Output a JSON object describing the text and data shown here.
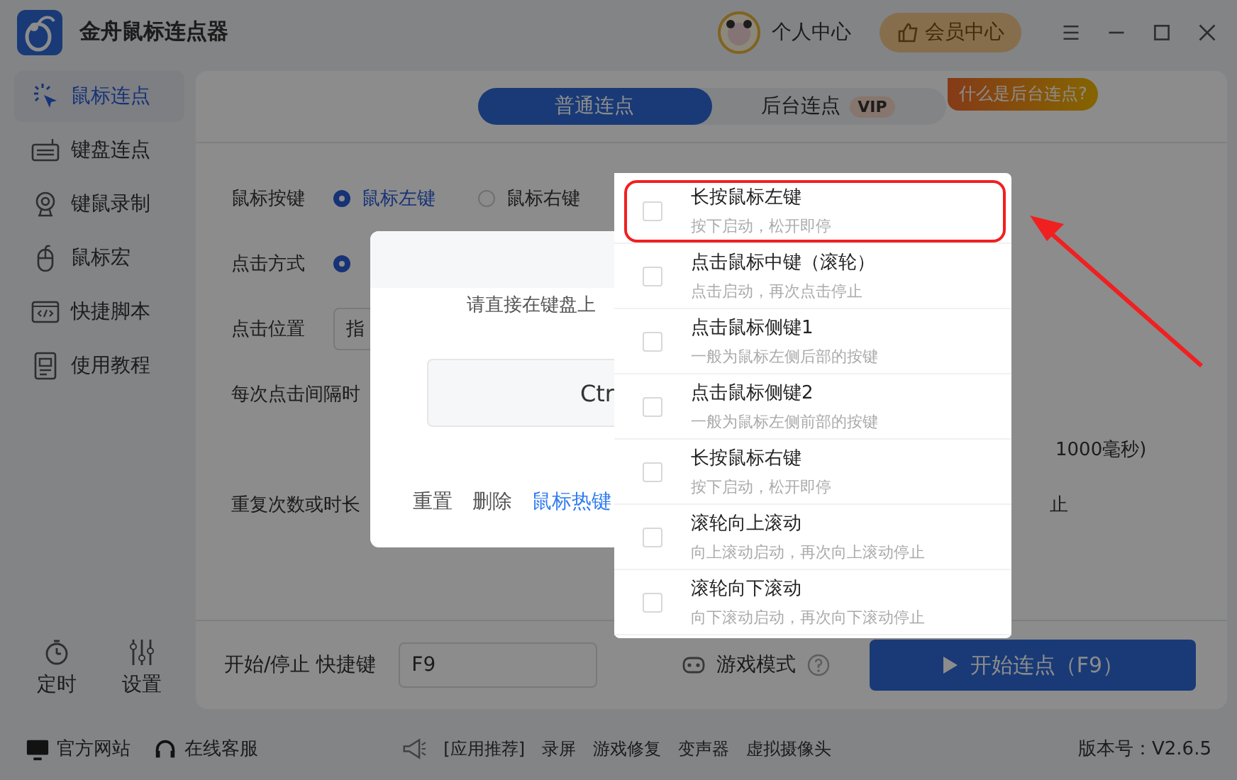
{
  "app": {
    "title": "金舟鼠标连点器",
    "user": "个人中心",
    "vip_button": "会员中心"
  },
  "sidebar": {
    "items": [
      {
        "label": "鼠标连点",
        "kind": "cursor",
        "selected": true
      },
      {
        "label": "键盘连点",
        "kind": "keyboard",
        "selected": false
      },
      {
        "label": "键鼠录制",
        "kind": "webcam",
        "selected": false
      },
      {
        "label": "鼠标宏",
        "kind": "mouse",
        "selected": false
      },
      {
        "label": "快捷脚本",
        "kind": "code",
        "selected": false
      },
      {
        "label": "使用教程",
        "kind": "doc",
        "selected": false
      }
    ],
    "tools": [
      {
        "label": "定时",
        "kind": "timer"
      },
      {
        "label": "设置",
        "kind": "sliders"
      }
    ]
  },
  "tabs": [
    {
      "label": "普通连点",
      "selected": true
    },
    {
      "label": "后台连点",
      "selected": false,
      "badge": "VIP"
    }
  ],
  "help_tag": "什么是后台连点?",
  "form": {
    "mouse_button": {
      "label": "鼠标按键",
      "options": [
        {
          "label": "鼠标左键",
          "selected": true
        },
        {
          "label": "鼠标右键",
          "selected": false
        }
      ]
    },
    "click_mode": {
      "label": "点击方式",
      "selected": true
    },
    "click_position": {
      "label": "点击位置",
      "value": "指"
    },
    "interval": {
      "label": "每次点击间隔时",
      "note": "1000毫秒)"
    },
    "repeat": {
      "label": "重复次数或时长",
      "note": "止"
    }
  },
  "bottom": {
    "hotkey_label": "开始/停止 快捷键",
    "hotkey_value": "F9",
    "game_mode": "游戏模式",
    "start_button": "开始连点（F9）"
  },
  "footer": {
    "links": [
      {
        "label": "官方网站",
        "kind": "monitor"
      },
      {
        "label": "在线客服",
        "kind": "headset"
      }
    ],
    "recommend": [
      "[应用推荐]",
      "录屏",
      "游戏修复",
      "变声器",
      "虚拟摄像头"
    ],
    "version": "版本号：V2.6.5"
  },
  "modal": {
    "prompt": "请直接在键盘上",
    "key": "Ctr",
    "actions": [
      {
        "label": "重置",
        "kind": "plain"
      },
      {
        "label": "删除",
        "kind": "plain"
      },
      {
        "label": "鼠标热键",
        "kind": "link"
      }
    ]
  },
  "dropdown": {
    "items": [
      {
        "title": "长按鼠标左键",
        "desc": "按下启动，松开即停",
        "checked": false,
        "highlighted": true
      },
      {
        "title": "点击鼠标中键（滚轮）",
        "desc": "点击启动，再次点击停止",
        "checked": false,
        "highlighted": false
      },
      {
        "title": "点击鼠标侧键1",
        "desc": "一般为鼠标左侧后部的按键",
        "checked": false,
        "highlighted": false
      },
      {
        "title": "点击鼠标侧键2",
        "desc": "一般为鼠标左侧前部的按键",
        "checked": false,
        "highlighted": false
      },
      {
        "title": "长按鼠标右键",
        "desc": "按下启动，松开即停",
        "checked": false,
        "highlighted": false
      },
      {
        "title": "滚轮向上滚动",
        "desc": "向上滚动启动，再次向上滚动停止",
        "checked": false,
        "highlighted": false
      },
      {
        "title": "滚轮向下滚动",
        "desc": "向下滚动启动，再次向下滚动停止",
        "checked": false,
        "highlighted": false
      }
    ]
  }
}
